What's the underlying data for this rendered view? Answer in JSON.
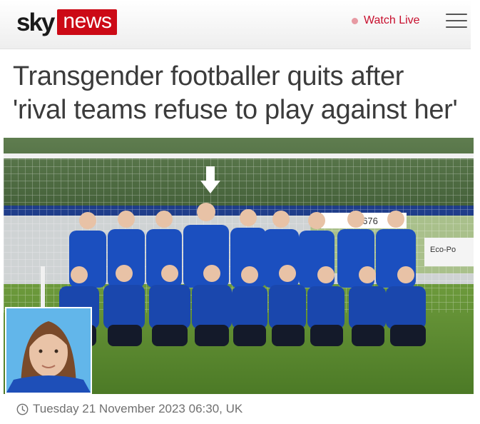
{
  "header": {
    "logo_sky": "sky",
    "logo_news": "news",
    "watch_live_label": "Watch Live",
    "menu_icon": "hamburger-menu-icon",
    "brand_color": "#cc0a16",
    "live_color": "#c8102e"
  },
  "article": {
    "headline_line1": "Transgender footballer quits after",
    "headline_line2": "'rival teams refuse to play against her'",
    "date": "Tuesday 21 November 2023 06:30, UK",
    "date_icon": "clock-icon"
  },
  "hero_image": {
    "icon": "down-arrow-icon",
    "sign_text": "2 0676",
    "sign_text2": "Eco-Po"
  }
}
